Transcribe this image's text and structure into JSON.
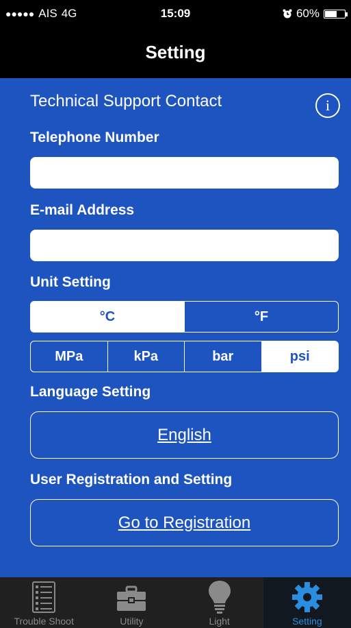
{
  "status_bar": {
    "signal_dots": "●●●●●",
    "carrier": "AIS",
    "network": "4G",
    "time": "15:09",
    "battery_percent": "60%",
    "battery_level": 0.6
  },
  "nav": {
    "title": "Setting"
  },
  "support": {
    "section_title": "Technical Support Contact",
    "info_glyph": "i",
    "telephone_label": "Telephone Number",
    "telephone_value": "",
    "email_label": "E-mail Address",
    "email_value": ""
  },
  "units": {
    "label": "Unit Setting",
    "temperature": {
      "options": [
        "°C",
        "°F"
      ],
      "selected": "°C"
    },
    "pressure": {
      "options": [
        "MPa",
        "kPa",
        "bar",
        "psi"
      ],
      "selected": "psi"
    }
  },
  "language": {
    "label": "Language Setting",
    "value": "English"
  },
  "registration": {
    "label": "User Registration and Setting",
    "button": "Go to Registration"
  },
  "tabs": [
    {
      "label": "Trouble Shoot",
      "icon": "list-icon",
      "active": false
    },
    {
      "label": "Utility",
      "icon": "toolbox-icon",
      "active": false
    },
    {
      "label": "Light",
      "icon": "lightbulb-icon",
      "active": false
    },
    {
      "label": "Setting",
      "icon": "gear-icon",
      "active": true
    }
  ],
  "colors": {
    "background_blue": "#1e54c0",
    "tab_active": "#2a8ee0",
    "tab_inactive": "#8a8a8a",
    "tabbar": "#202020"
  }
}
